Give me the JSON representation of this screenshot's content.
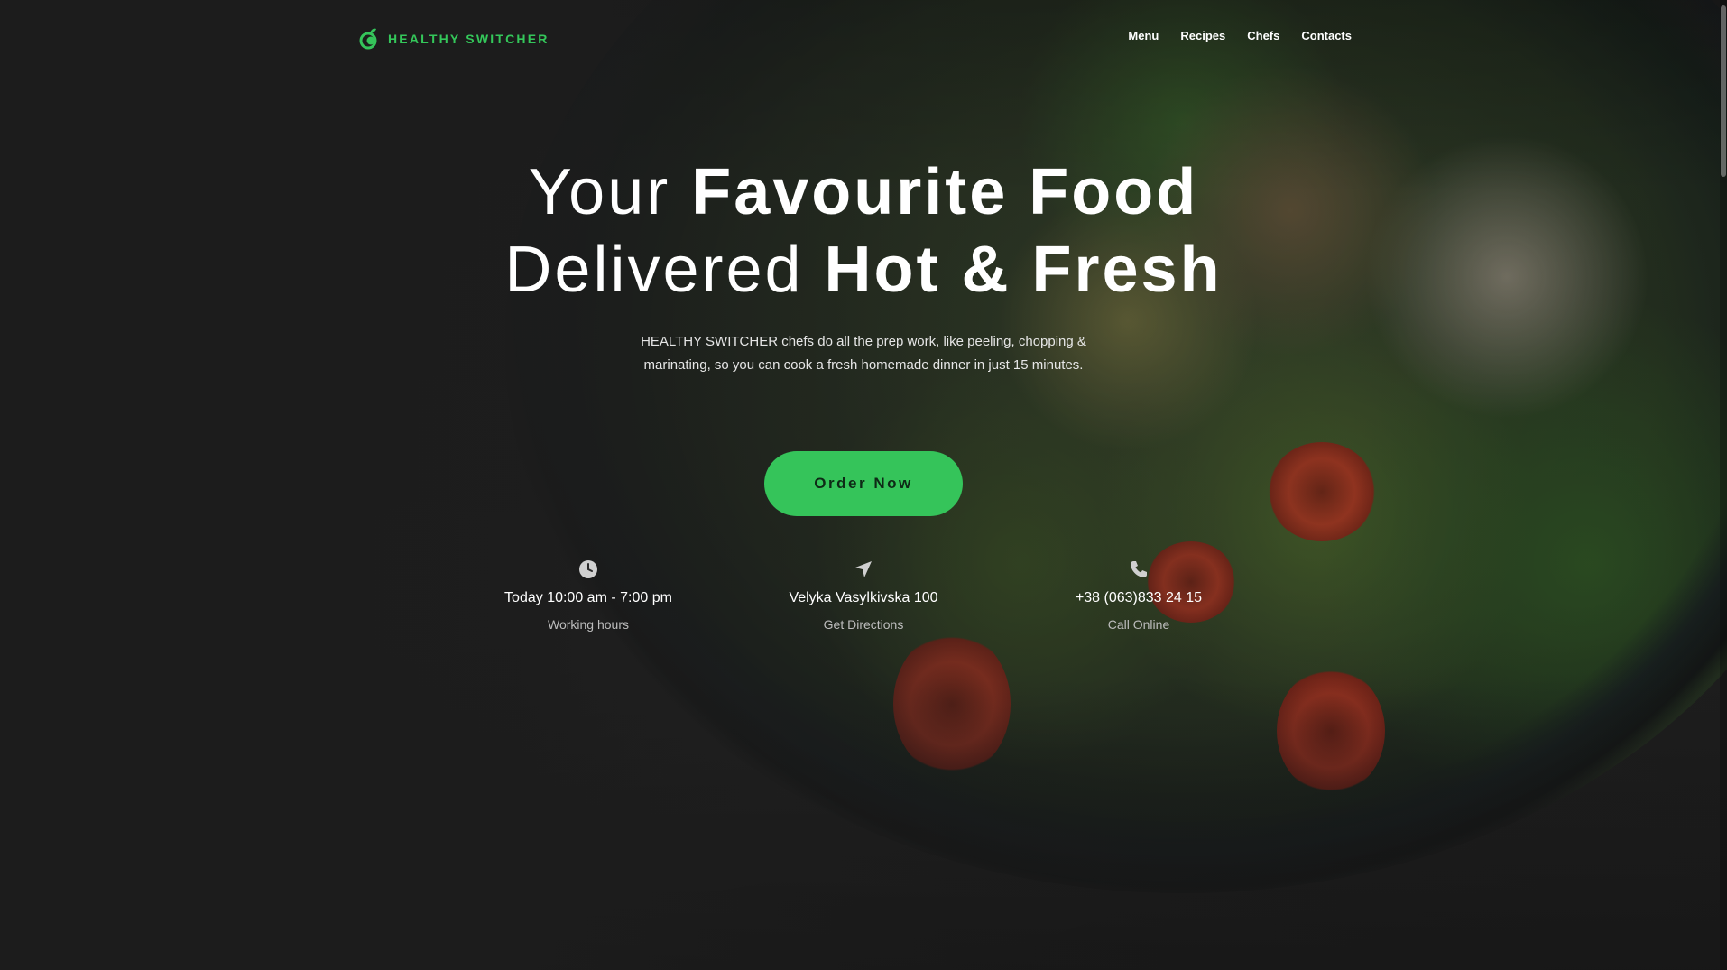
{
  "brand": {
    "name": "HEALTHY SWITCHER",
    "accent_color": "#35c45a"
  },
  "nav": {
    "items": [
      "Menu",
      "Recipes",
      "Chefs",
      "Contacts"
    ]
  },
  "hero": {
    "title_line1_light": "Your ",
    "title_line1_bold": "Favourite Food",
    "title_line2_light": "Delivered ",
    "title_line2_bold": "Hot & Fresh",
    "subtitle": "HEALTHY SWITCHER chefs do all the prep work, like peeling, chopping & marinating, so you can cook a fresh homemade dinner in just 15 minutes.",
    "cta_label": "Order Now"
  },
  "info": [
    {
      "icon": "clock-icon",
      "main": "Today 10:00 am - 7:00 pm",
      "label": "Working hours"
    },
    {
      "icon": "location-arrow-icon",
      "main": "Velyka Vasylkivska 100",
      "label": "Get Directions"
    },
    {
      "icon": "phone-icon",
      "main": "+38 (063)833 24 15",
      "label": "Call Online"
    }
  ]
}
